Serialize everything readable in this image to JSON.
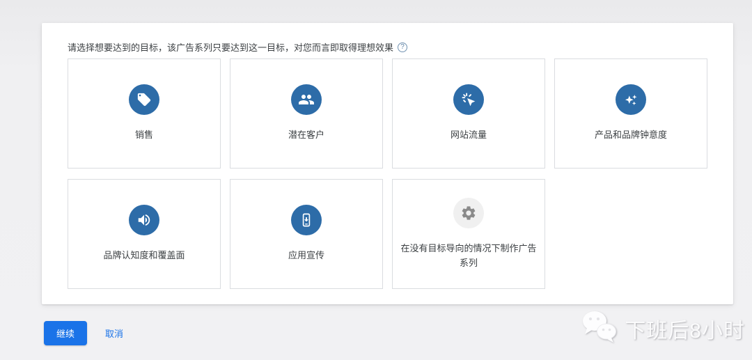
{
  "header": {
    "title": "请选择想要达到的目标，该广告系列只要达到这一目标，对您而言即取得理想效果",
    "help_glyph": "?"
  },
  "goals": [
    {
      "label": "销售",
      "icon": "tag-icon",
      "circle_color": "#2d6ca8"
    },
    {
      "label": "潜在客户",
      "icon": "people-icon",
      "circle_color": "#2d6ca8"
    },
    {
      "label": "网站流量",
      "icon": "cursor-click-icon",
      "circle_color": "#2d6ca8"
    },
    {
      "label": "产品和品牌钟意度",
      "icon": "sparkles-icon",
      "circle_color": "#2d6ca8"
    },
    {
      "label": "品牌认知度和覆盖面",
      "icon": "speaker-icon",
      "circle_color": "#2d6ca8"
    },
    {
      "label": "应用宣传",
      "icon": "phone-download-icon",
      "circle_color": "#2d6ca8"
    },
    {
      "label": "在没有目标导向的情况下制作广告系列",
      "icon": "gear-icon",
      "circle_color": "#f0f0f0",
      "icon_color": "#8a8a8a"
    }
  ],
  "footer": {
    "continue_label": "继续",
    "cancel_label": "取消"
  },
  "watermark": {
    "text": "下班后8小时"
  },
  "colors": {
    "accent_blue": "#1a73e8",
    "goal_icon_blue": "#2d6ca8",
    "neutral_gray_icon": "#8a8a8a",
    "card_border": "#dadce0",
    "text_primary": "#3c4043",
    "page_background": "#f1f1f3"
  }
}
